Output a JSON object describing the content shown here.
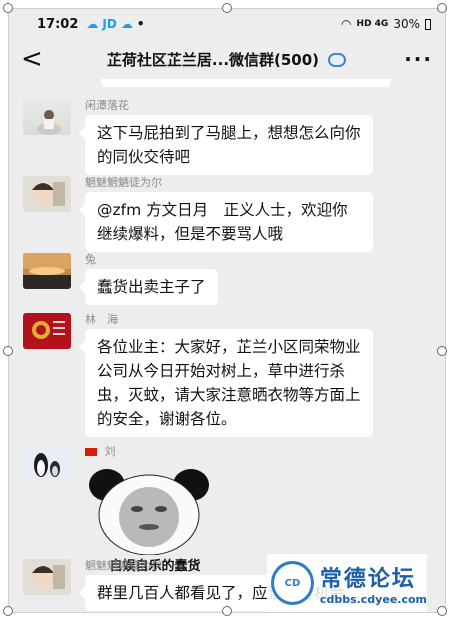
{
  "status_bar": {
    "time": "17:02",
    "notif": "JD",
    "dot": "•",
    "signal": "HD 4G",
    "battery": "30%"
  },
  "nav": {
    "back": "<",
    "title": "芷荷社区芷兰居...微信群(500)",
    "more": "···"
  },
  "messages": [
    {
      "sender": "闲潭落花",
      "text": "这下马屁拍到了马腿上，想想怎么向你的同伙交待吧",
      "avatar": "seated-figure"
    },
    {
      "sender": "魍魅魍魉徒为尔",
      "text": "@zfm 方文日月　正义人士，欢迎你继续爆料，但是不要骂人哦",
      "avatar": "child"
    },
    {
      "sender": "兔",
      "text": "蠢货出卖主子了",
      "avatar": "sunset"
    },
    {
      "sender": "林　海",
      "text": "各位业主：大家好，芷兰小区同荣物业公司从今日开始对树上，草中进行杀虫，灭蚊，请大家注意晒衣物等方面上的安全，谢谢各位。",
      "avatar": "emblem"
    },
    {
      "sender": "刘",
      "sticker_caption": "自娱自乐的蠢货",
      "avatar": "penguins"
    },
    {
      "sender": "魍魅魍魉徒为尔",
      "text": "群里几百人都看见了，应该会有机会…",
      "avatar": "child"
    }
  ],
  "watermark": {
    "title": "常德论坛",
    "url": "cdbbs.cdyee.com"
  }
}
